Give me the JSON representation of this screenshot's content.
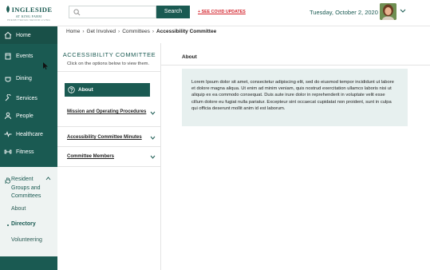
{
  "header": {
    "logo": {
      "name": "INGLESIDE",
      "sub": "AT KING FARM",
      "tagline": "PRESBYTERIAN SENIOR LIVING"
    },
    "search": {
      "placeholder": "",
      "button_label": "Search"
    },
    "covid_link": "+ SEE COVID UPDATES",
    "date": "Tuesday, October 2, 2020"
  },
  "sidebar": {
    "items": [
      {
        "label": "Home",
        "icon": "home-icon"
      },
      {
        "label": "Events",
        "icon": "calendar-icon"
      },
      {
        "label": "Dining",
        "icon": "dining-icon"
      },
      {
        "label": "Services",
        "icon": "wrench-icon"
      },
      {
        "label": "People",
        "icon": "person-icon"
      },
      {
        "label": "Healthcare",
        "icon": "heartbeat-icon"
      },
      {
        "label": "Fitness",
        "icon": "dumbbell-icon"
      }
    ],
    "resident_group": {
      "label": "Resident Groups and Committees",
      "icon": "hand-icon",
      "sub_items": [
        {
          "label": "About",
          "active": false
        },
        {
          "label": "Directory",
          "active": true
        },
        {
          "label": "Volunteering",
          "active": false
        }
      ]
    }
  },
  "breadcrumb": {
    "items": [
      "Home",
      "Get Involved",
      "Committees"
    ],
    "current": "Accessibility Committee"
  },
  "committee_nav": {
    "title": "ACCESSIBILITY COMMITTEE",
    "description": "Click on the options below to view them.",
    "active_item": "About",
    "sections": [
      "Mission and Operating Procedures",
      "Accessibility Committee Minutes",
      "Committee Members"
    ]
  },
  "main": {
    "heading": "About",
    "body": "Lorem Ipsum dolor sit amet, consectetur adipiscing elit, sed do eiusmod tempor incididunt ut labore et dolore magna aliqua. Ut enim ad minim veniam, quis nostrud exercitation ullamco laboris nisi ut aliquip ex ea commodo consequat. Duis aute irure dolor in reprehenderit in voluptate velit esse cillum dolore eu fugiat nulla pariatur. Excepteur sint occaecat cupidatat non proident, sunt in culpa qui officia deserunt mollit anim id est laborum."
  },
  "colors": {
    "brand_teal": "#1a5a52",
    "covid_red": "#d4242d",
    "card_background": "#e7f0ef"
  }
}
